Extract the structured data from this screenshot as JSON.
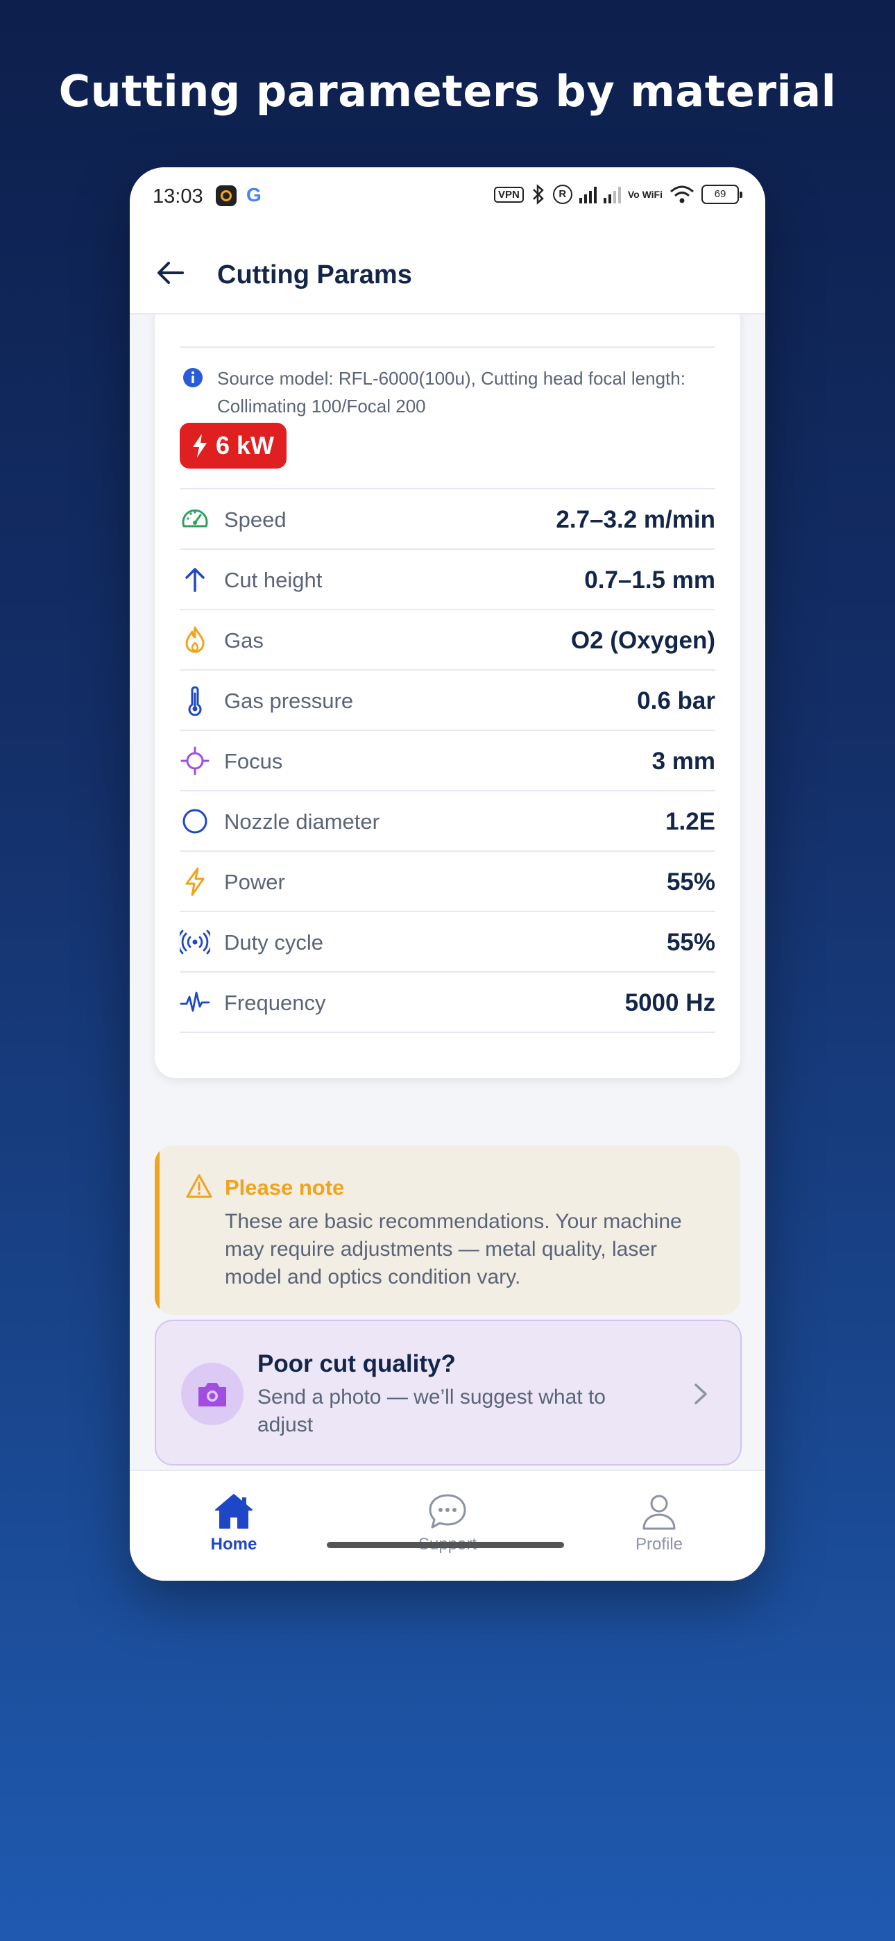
{
  "page": {
    "headline": "Cutting parameters by material"
  },
  "statusbar": {
    "time": "13:03",
    "vpn_label": "VPN",
    "registered_mark": "R",
    "vowifi_label": "Vo WiFi",
    "battery_level": "69"
  },
  "header": {
    "title": "Cutting Params"
  },
  "source": {
    "text": "Source model: RFL-6000(100u), Cutting head focal length: Collimating 100/Focal 200",
    "power_badge": "6 kW"
  },
  "params": [
    {
      "icon": "speedometer-icon",
      "label": "Speed",
      "value": "2.7–3.2 m/min",
      "color": "#2fa05a"
    },
    {
      "icon": "arrow-up-icon",
      "label": "Cut height",
      "value": "0.7–1.5 mm",
      "color": "#1e47c8"
    },
    {
      "icon": "flame-icon",
      "label": "Gas",
      "value": "O2 (Oxygen)",
      "color": "#f0a31b"
    },
    {
      "icon": "thermometer-icon",
      "label": "Gas pressure",
      "value": "0.6 bar",
      "color": "#1e47c8"
    },
    {
      "icon": "crosshair-icon",
      "label": "Focus",
      "value": "3 mm",
      "color": "#a14ee0"
    },
    {
      "icon": "circle-icon",
      "label": "Nozzle diameter",
      "value": "1.2E",
      "color": "#1e47c8"
    },
    {
      "icon": "lightning-icon",
      "label": "Power",
      "value": "55%",
      "color": "#f0a31b"
    },
    {
      "icon": "broadcast-icon",
      "label": "Duty cycle",
      "value": "55%",
      "color": "#1e47c8"
    },
    {
      "icon": "pulse-icon",
      "label": "Frequency",
      "value": "5000 Hz",
      "color": "#1e47c8"
    }
  ],
  "note": {
    "title": "Please note",
    "body": "These are basic recommendations. Your machine may require adjustments — metal quality, laser model and optics condition vary."
  },
  "promo": {
    "title": "Poor cut quality?",
    "subtitle": "Send a photo — we’ll suggest what to adjust"
  },
  "tabs": [
    {
      "icon": "home-icon",
      "label": "Home",
      "active": true
    },
    {
      "icon": "chat-icon",
      "label": "Support",
      "active": false
    },
    {
      "icon": "user-icon",
      "label": "Profile",
      "active": false
    }
  ],
  "colors": {
    "accent": "#1e47c8",
    "badge_red": "#e02020",
    "warning": "#f0a31b",
    "title_text": "#13264a",
    "muted_text": "#5a6478"
  }
}
